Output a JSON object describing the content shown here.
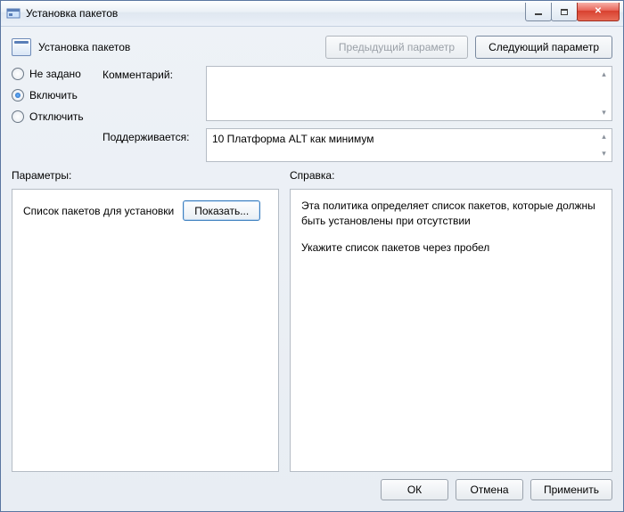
{
  "window": {
    "title": "Установка пакетов"
  },
  "header": {
    "title": "Установка пакетов",
    "prev_btn": "Предыдущий параметр",
    "next_btn": "Следующий параметр"
  },
  "state": {
    "options": {
      "not_configured": "Не задано",
      "enabled": "Включить",
      "disabled": "Отключить"
    },
    "selected": "enabled"
  },
  "info": {
    "comment_label": "Комментарий:",
    "comment_value": "",
    "supported_label": "Поддерживается:",
    "supported_value": "10 Платформа ALT как минимум"
  },
  "sections": {
    "params_label": "Параметры:",
    "help_label": "Справка:"
  },
  "params": {
    "list_label": "Список пакетов для установки",
    "show_btn": "Показать..."
  },
  "help": {
    "p1": "Эта политика определяет список пакетов, которые должны быть установлены при отсутствии",
    "p2": "Укажите список пакетов через пробел"
  },
  "footer": {
    "ok": "ОК",
    "cancel": "Отмена",
    "apply": "Применить"
  }
}
